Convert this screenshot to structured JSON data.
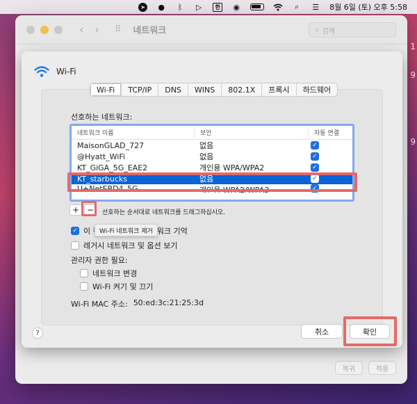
{
  "menubar": {
    "ime_label": "한",
    "clock": "8월 6일 (토) 오후 5:58"
  },
  "background_window": {
    "title": "네트워크",
    "search_placeholder": "검색",
    "revert_label": "복귀",
    "apply_label": "적용",
    "side_numbers": [
      "1",
      "9",
      "9"
    ]
  },
  "sheet": {
    "header_label": "Wi-Fi",
    "tabs": [
      {
        "label": "Wi-Fi",
        "active": true
      },
      {
        "label": "TCP/IP"
      },
      {
        "label": "DNS"
      },
      {
        "label": "WINS"
      },
      {
        "label": "802.1X"
      },
      {
        "label": "프록시"
      },
      {
        "label": "하드웨어"
      }
    ],
    "preferred_networks_label": "선호하는 네트워크:",
    "table": {
      "headers": [
        "네트워크 이름",
        "보안",
        "자동 연결"
      ],
      "rows": [
        {
          "name": "MaisonGLAD_727",
          "security": "없음",
          "auto": true
        },
        {
          "name": "@Hyatt_WiFi",
          "security": "없음",
          "auto": true
        },
        {
          "name": "KT_GiGA_5G_EAE2",
          "security": "개인용 WPA/WPA2",
          "auto": true
        },
        {
          "name": "KT_starbucks",
          "security": "없음",
          "auto": true,
          "selected": true
        },
        {
          "name": "U+NetEBD4_5G",
          "security": "개인용 WPA2/WPA3",
          "auto": true
        }
      ]
    },
    "add_label": "+",
    "remove_label": "−",
    "drag_hint": "선호하는 순서대로 네트워크를 드래그하십시오.",
    "tooltip": "Wi-Fi 네트워크 제거",
    "remember_prefix": "이 컴",
    "remember_suffix": "워크 기억",
    "legacy_label": "레거시 네트워크 및 옵션 보기",
    "admin_label": "관리자 권한 필요:",
    "admin_change_network": "네트워크 변경",
    "admin_wifi_toggle": "Wi-Fi 켜기 및 끄기",
    "mac_label": "Wi-Fi MAC 주소:",
    "mac_value": "50:ed:3c:21:25:3d",
    "help_label": "?",
    "cancel_label": "취소",
    "ok_label": "확인"
  },
  "colors": {
    "accent": "#0a64d8",
    "highlight": "#e26a6a",
    "table_focus": "#84a8ee"
  }
}
